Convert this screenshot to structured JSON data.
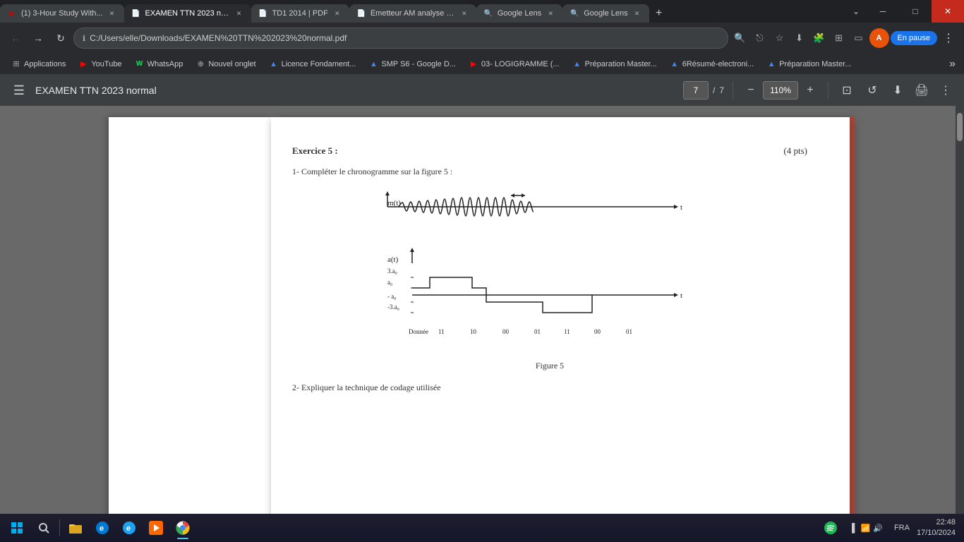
{
  "titlebar": {
    "tabs": [
      {
        "id": "tab1",
        "favicon_color": "#c00",
        "favicon": "▶",
        "label": "(1) 3-Hour Study With...",
        "active": false,
        "closable": true
      },
      {
        "id": "tab2",
        "favicon_color": "#1a73e8",
        "favicon": "📄",
        "label": "EXAMEN TTN 2023 nor...",
        "active": true,
        "closable": true
      },
      {
        "id": "tab3",
        "favicon_color": "#1a73e8",
        "favicon": "📄",
        "label": "TD1 2014 | PDF",
        "active": false,
        "closable": true
      },
      {
        "id": "tab4",
        "favicon_color": "#1a73e8",
        "favicon": "📄",
        "label": "Émetteur AM analyse s...",
        "active": false,
        "closable": true
      },
      {
        "id": "tab5",
        "favicon_color": "#4285f4",
        "favicon": "🔍",
        "label": "Google Lens",
        "active": false,
        "closable": true
      },
      {
        "id": "tab6",
        "favicon_color": "#4285f4",
        "favicon": "🔍",
        "label": "Google Lens",
        "active": false,
        "closable": true
      }
    ],
    "controls": {
      "minimize": "─",
      "maximize": "□",
      "close": "✕"
    }
  },
  "addressbar": {
    "back": "←",
    "forward": "→",
    "reload": "↻",
    "url": "C:/Users/elle/Downloads/EXAMEN%20TTN%202023%20normal.pdf",
    "search_icon": "🔍",
    "share_icon": "⎋",
    "star_icon": "☆",
    "download_icon": "⬇",
    "extensions_icon": "🧩",
    "grid_icon": "⊞",
    "sidebar_icon": "▭",
    "profile_label": "A",
    "en_pause_label": "En pause",
    "menu_icon": "⋮"
  },
  "bookmarks": {
    "items": [
      {
        "id": "bm1",
        "favicon": "⊞",
        "label": "Applications",
        "color": "#aaa"
      },
      {
        "id": "bm2",
        "favicon": "▶",
        "label": "YouTube",
        "color": "#f00"
      },
      {
        "id": "bm3",
        "favicon": "W",
        "label": "WhatsApp",
        "color": "#25d366"
      },
      {
        "id": "bm4",
        "favicon": "⊕",
        "label": "Nouvel onglet",
        "color": "#aaa"
      },
      {
        "id": "bm5",
        "favicon": "▲",
        "label": "Licence Fondament...",
        "color": "#4285f4"
      },
      {
        "id": "bm6",
        "favicon": "▲",
        "label": "SMP S6 - Google D...",
        "color": "#4285f4"
      },
      {
        "id": "bm7",
        "favicon": "▶",
        "label": "03- LOGIGRAMME (...",
        "color": "#f00"
      },
      {
        "id": "bm8",
        "favicon": "▲",
        "label": "Préparation Master...",
        "color": "#4285f4"
      },
      {
        "id": "bm9",
        "favicon": "▲",
        "label": "6Résumé-electroni...",
        "color": "#4285f4"
      },
      {
        "id": "bm10",
        "favicon": "▲",
        "label": "Préparation Master...",
        "color": "#4285f4"
      }
    ],
    "more": "»"
  },
  "pdf_toolbar": {
    "menu_icon": "☰",
    "title": "EXAMEN TTN 2023 normal",
    "page_current": "7",
    "page_sep": "/",
    "page_total": "7",
    "zoom_minus": "−",
    "zoom_value": "110%",
    "zoom_plus": "+",
    "fit_icon": "⊡",
    "rotate_icon": "↺",
    "download_icon": "⬇",
    "print_icon": "🖨",
    "more_icon": "⋮"
  },
  "pdf_content": {
    "exercise_title": "Exercice 5 :",
    "exercise_pts": "(4 pts)",
    "question1": "1- Compléter le chronogramme sur la figure 5 :",
    "figure_label": "Figure 5",
    "question2": "2- Expliquer la technique de codage utilisée"
  },
  "taskbar": {
    "start_icon": "⊞",
    "items": [
      {
        "id": "tb1",
        "label": "File Explorer",
        "icon": "📁",
        "active": false
      },
      {
        "id": "tb2",
        "label": "Edge",
        "icon": "e",
        "active": false,
        "color": "#0078d4"
      },
      {
        "id": "tb3",
        "label": "IE",
        "icon": "e",
        "active": false,
        "color": "#1da1f2"
      },
      {
        "id": "tb4",
        "label": "Media Player",
        "icon": "▶",
        "active": false
      },
      {
        "id": "tb5",
        "label": "Chrome",
        "icon": "●",
        "active": true
      }
    ],
    "spotify_icon": "♫",
    "time": "22:48",
    "date": "17/10/2024",
    "lang": "FRA",
    "sys_icons": [
      "♪",
      "📶",
      "🔊"
    ]
  }
}
